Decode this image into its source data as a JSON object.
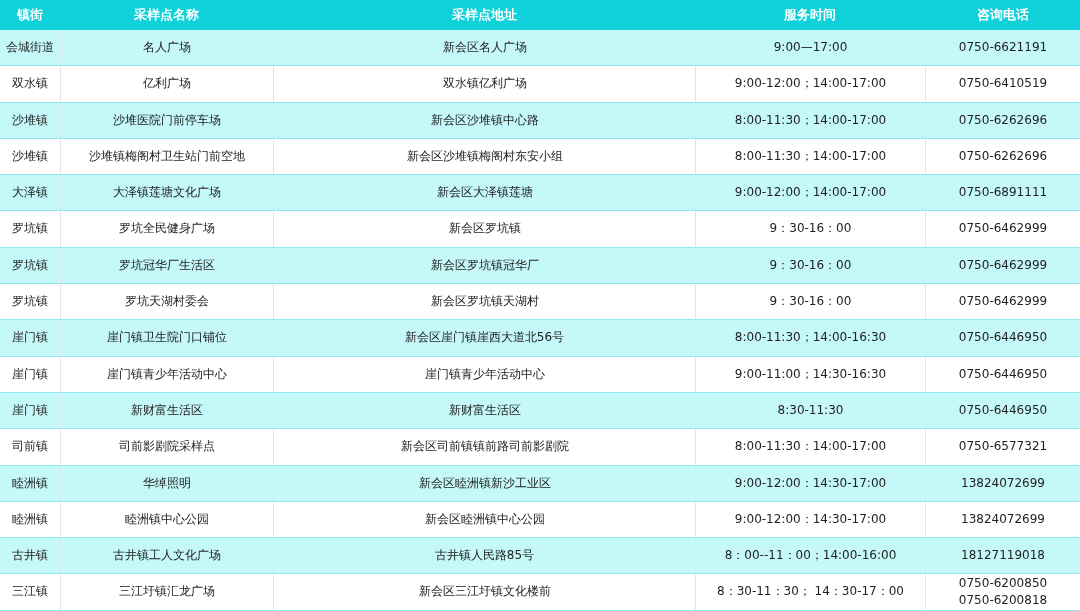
{
  "table": {
    "columns": [
      "镇街",
      "采样点名称",
      "采样点地址",
      "服务时间",
      "咨询电话"
    ],
    "rows": [
      {
        "town": "会城街道",
        "site": "名人广场",
        "address": "新会区名人广场",
        "hours": "9:00—17:00",
        "phone": "0750-6621191"
      },
      {
        "town": "双水镇",
        "site": "亿利广场",
        "address": "双水镇亿利广场",
        "hours": "9:00-12:00；14:00-17:00",
        "phone": "0750-6410519"
      },
      {
        "town": "沙堆镇",
        "site": "沙堆医院门前停车场",
        "address": "新会区沙堆镇中心路",
        "hours": "8:00-11:30；14:00-17:00",
        "phone": "0750-6262696"
      },
      {
        "town": "沙堆镇",
        "site": "沙堆镇梅阁村卫生站门前空地",
        "address": "新会区沙堆镇梅阁村东安小组",
        "hours": "8:00-11:30；14:00-17:00",
        "phone": "0750-6262696"
      },
      {
        "town": "大泽镇",
        "site": "大泽镇莲塘文化广场",
        "address": "新会区大泽镇莲塘",
        "hours": "9:00-12:00；14:00-17:00",
        "phone": "0750-6891111"
      },
      {
        "town": "罗坑镇",
        "site": "罗坑全民健身广场",
        "address": "新会区罗坑镇",
        "hours": "9：30-16：00",
        "phone": "0750-6462999"
      },
      {
        "town": "罗坑镇",
        "site": "罗坑冠华厂生活区",
        "address": "新会区罗坑镇冠华厂",
        "hours": "9：30-16：00",
        "phone": "0750-6462999"
      },
      {
        "town": "罗坑镇",
        "site": "罗坑天湖村委会",
        "address": "新会区罗坑镇天湖村",
        "hours": "9：30-16：00",
        "phone": "0750-6462999"
      },
      {
        "town": "崖门镇",
        "site": "崖门镇卫生院门口铺位",
        "address": "新会区崖门镇崖西大道北56号",
        "hours": "8:00-11:30；14:00-16:30",
        "phone": "0750-6446950"
      },
      {
        "town": "崖门镇",
        "site": "崖门镇青少年活动中心",
        "address": "崖门镇青少年活动中心",
        "hours": "9:00-11:00；14:30-16:30",
        "phone": "0750-6446950"
      },
      {
        "town": "崖门镇",
        "site": "新财富生活区",
        "address": "新财富生活区",
        "hours": "8:30-11:30",
        "phone": "0750-6446950"
      },
      {
        "town": "司前镇",
        "site": "司前影剧院采样点",
        "address": "新会区司前镇镇前路司前影剧院",
        "hours": "8:00-11:30：14:00-17:00",
        "phone": "0750-6577321"
      },
      {
        "town": "睦洲镇",
        "site": "华绰照明",
        "address": "新会区睦洲镇新沙工业区",
        "hours": "9:00-12:00：14:30-17:00",
        "phone": "13824072699"
      },
      {
        "town": "睦洲镇",
        "site": "睦洲镇中心公园",
        "address": "新会区睦洲镇中心公园",
        "hours": "9:00-12:00：14:30-17:00",
        "phone": "13824072699"
      },
      {
        "town": "古井镇",
        "site": "古井镇工人文化广场",
        "address": "古井镇人民路85号",
        "hours": "8：00--11：00；14:00-16:00",
        "phone": "18127119018"
      },
      {
        "town": "三江镇",
        "site": "三江圩镇汇龙广场",
        "address": "新会区三江圩镇文化楼前",
        "hours": "8：30-11：30；  14：30-17：00",
        "phone": "0750-6200850\n0750-6200818"
      }
    ]
  }
}
